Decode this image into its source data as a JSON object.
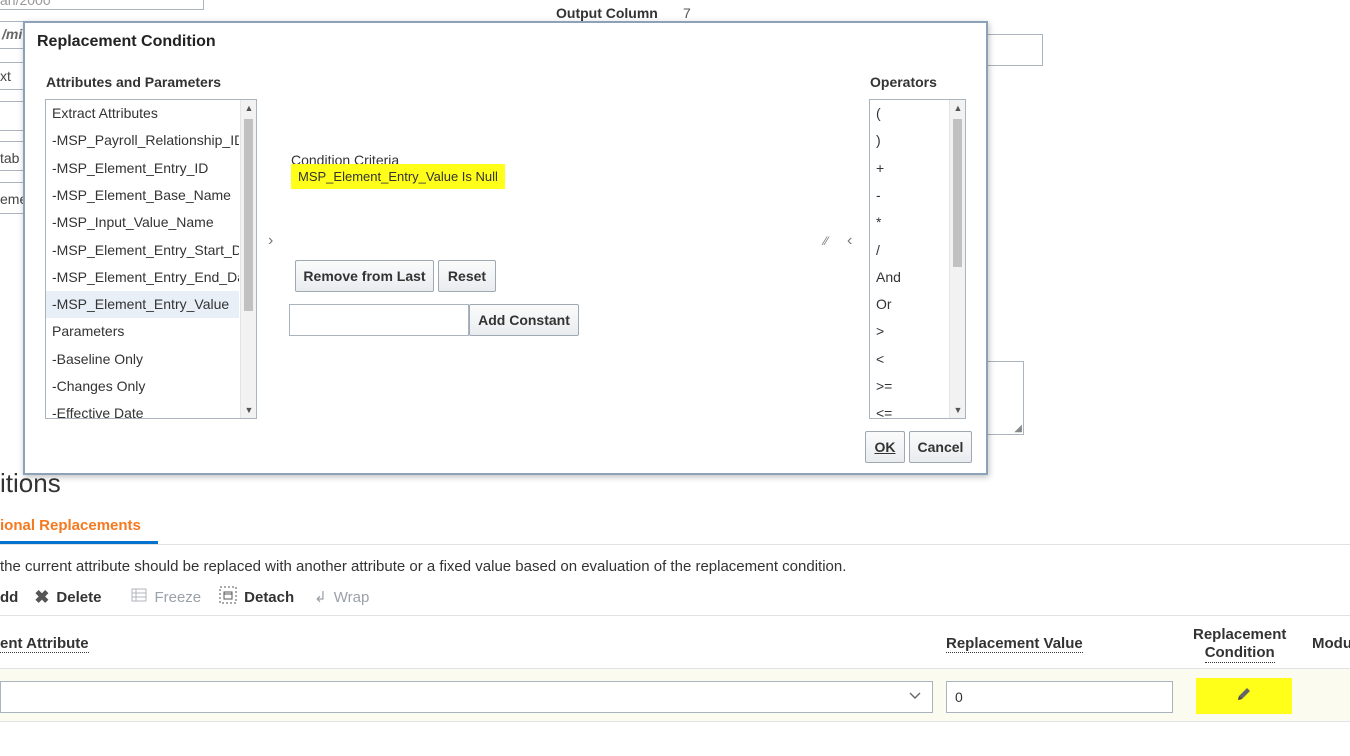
{
  "background": {
    "fragments": {
      "date_fragment": "an/2000",
      "mask_fragment": "/mi",
      "text_fragment": "xt",
      "tab_fragment": "tab",
      "eme_fragment": "eme"
    },
    "output_column": {
      "label": "Output Column",
      "value": "7"
    },
    "section_title": "itions",
    "active_tab": "ional Replacements",
    "description": "the current attribute should be replaced with another attribute or a fixed value based on evaluation of the replacement condition.",
    "toolbar": {
      "add": "dd",
      "delete": "Delete",
      "freeze": "Freeze",
      "detach": "Detach",
      "wrap": "Wrap"
    },
    "table": {
      "columns": {
        "element_attribute": "ent Attribute",
        "replacement_value": "Replacement Value",
        "replacement_condition_line1": "Replacement",
        "replacement_condition_line2": "Condition",
        "modu": "Modu"
      },
      "row": {
        "replacement_value": "0"
      },
      "highlight_color": "#ffff1a"
    }
  },
  "dialog": {
    "title": "Replacement Condition",
    "attributes_label": "Attributes and Parameters",
    "attributes": [
      "Extract Attributes",
      "-MSP_Payroll_Relationship_ID",
      "-MSP_Element_Entry_ID",
      "-MSP_Element_Base_Name",
      "-MSP_Input_Value_Name",
      "-MSP_Element_Entry_Start_D",
      "-MSP_Element_Entry_End_Da",
      "-MSP_Element_Entry_Value",
      "Parameters",
      "-Baseline Only",
      "-Changes Only",
      "-Effective Date"
    ],
    "selected_attribute": "-MSP_Element_Entry_Value",
    "condition_label": "Condition Criteria",
    "condition_value": "MSP_Element_Entry_Value Is Null",
    "buttons": {
      "remove_from_last": "Remove from Last",
      "reset": "Reset",
      "add_constant": "Add Constant",
      "ok": "OK",
      "cancel": "Cancel"
    },
    "constant_input_value": "",
    "operators_label": "Operators",
    "operators": [
      "(",
      ")",
      "+",
      "-",
      "*",
      "/",
      "And",
      "Or",
      ">",
      "<",
      ">=",
      "<="
    ]
  }
}
